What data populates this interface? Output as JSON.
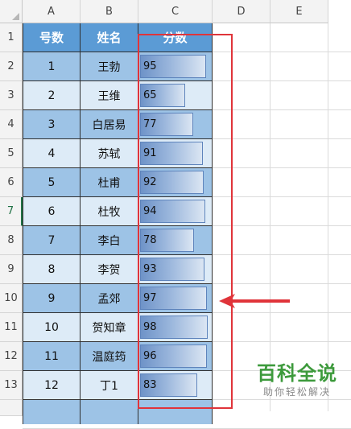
{
  "columns": [
    "A",
    "B",
    "C",
    "D",
    "E"
  ],
  "rows": [
    "1",
    "2",
    "3",
    "4",
    "5",
    "6",
    "7",
    "8",
    "9",
    "10",
    "11",
    "12",
    "13"
  ],
  "table": {
    "headers": [
      "号数",
      "姓名",
      "分数"
    ],
    "records": [
      {
        "no": "1",
        "name": "王勃",
        "score": "95",
        "score_value": 95
      },
      {
        "no": "2",
        "name": "王维",
        "score": "65",
        "score_value": 65
      },
      {
        "no": "3",
        "name": "白居易",
        "score": "77",
        "score_value": 77
      },
      {
        "no": "4",
        "name": "苏轼",
        "score": "91",
        "score_value": 91
      },
      {
        "no": "5",
        "name": "杜甫",
        "score": "92",
        "score_value": 92
      },
      {
        "no": "6",
        "name": "杜牧",
        "score": "94",
        "score_value": 94
      },
      {
        "no": "7",
        "name": "李白",
        "score": "78",
        "score_value": 78
      },
      {
        "no": "8",
        "name": "李贺",
        "score": "93",
        "score_value": 93
      },
      {
        "no": "9",
        "name": "孟郊",
        "score": "97",
        "score_value": 97
      },
      {
        "no": "10",
        "name": "贺知章",
        "score": "98",
        "score_value": 98
      },
      {
        "no": "11",
        "name": "温庭筠",
        "score": "96",
        "score_value": 96
      },
      {
        "no": "12",
        "name": "丁1",
        "score": "83",
        "score_value": 83
      }
    ]
  },
  "active_row": "7",
  "colors": {
    "header_fill": "#5b9bd5",
    "band_dark": "#9dc3e6",
    "band_light": "#ddebf7",
    "databar": "#6e93c8",
    "annotation": "#e0343a",
    "watermark": "#3d9a3c"
  },
  "watermark": {
    "title": "百科全说",
    "subtitle": "助你轻松解决"
  }
}
